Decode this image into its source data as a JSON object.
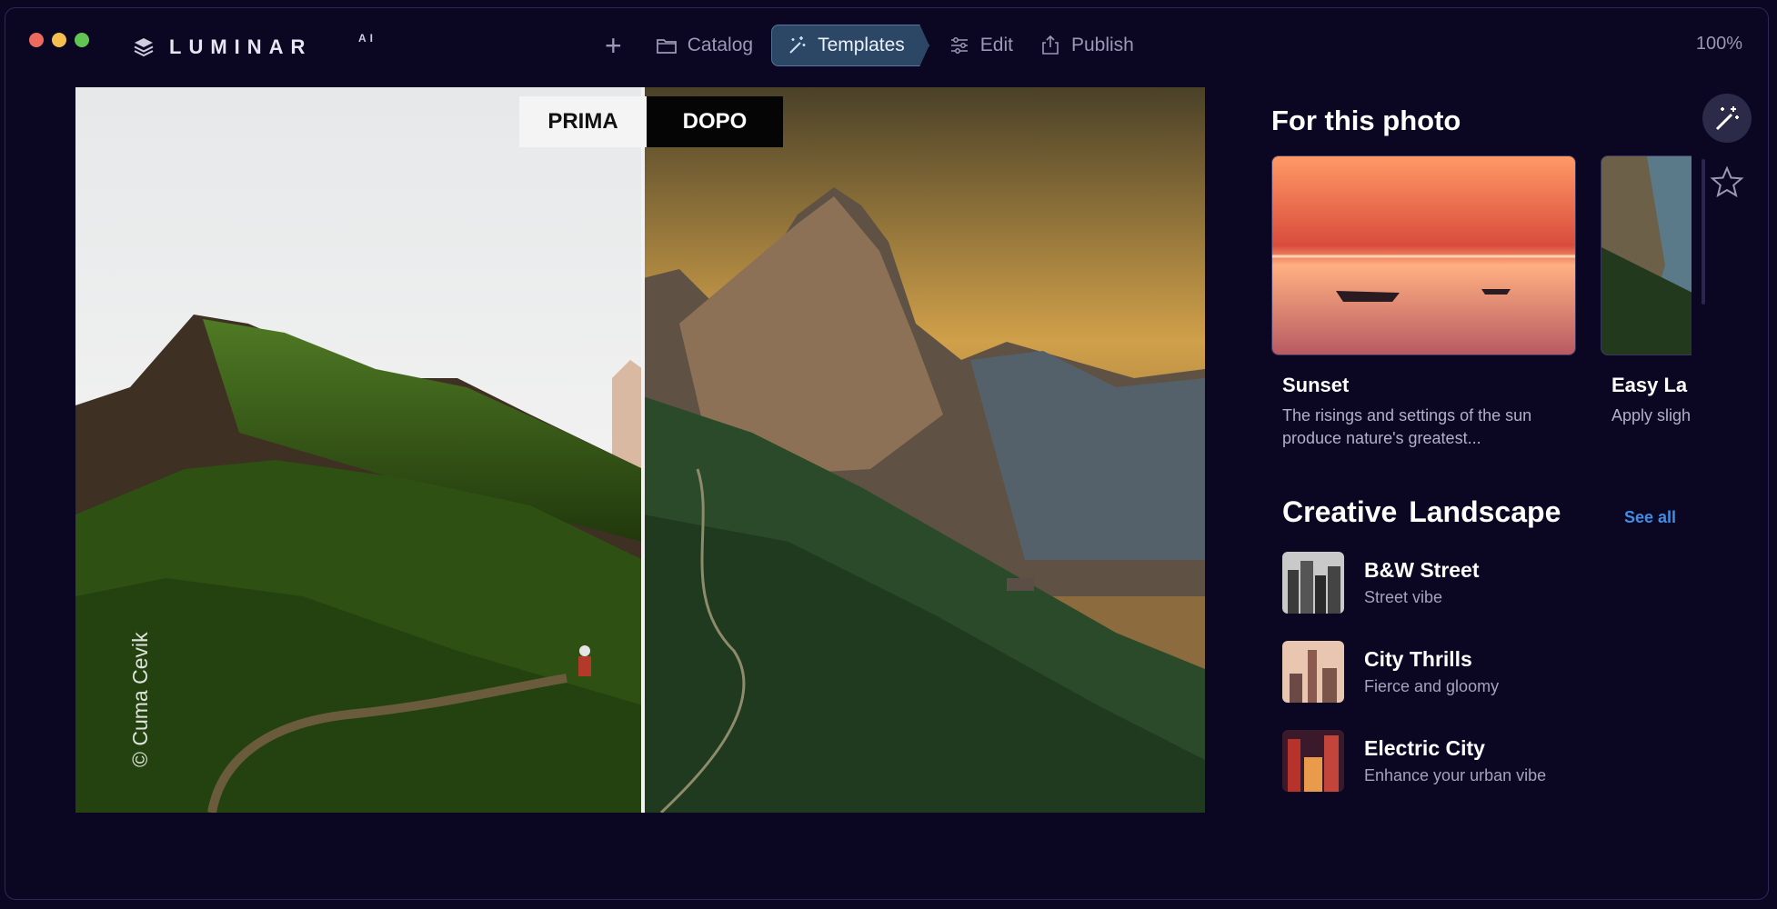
{
  "titlebar": {
    "brand_name": "LUMINAR",
    "brand_sup": "AI",
    "zoom": "100%"
  },
  "nav": {
    "add_label": "+",
    "items": [
      {
        "label": "Catalog",
        "icon": "folder-icon",
        "active": false
      },
      {
        "label": "Templates",
        "icon": "magic-wand-icon",
        "active": true
      },
      {
        "label": "Edit",
        "icon": "sliders-icon",
        "active": false
      },
      {
        "label": "Publish",
        "icon": "share-icon",
        "active": false
      }
    ]
  },
  "viewer": {
    "before_label": "PRIMA",
    "after_label": "DOPO",
    "credit": "© Cuma Cevik"
  },
  "panel": {
    "title": "For this photo",
    "cards": [
      {
        "title": "Sunset",
        "desc": "The risings and settings of the sun produce nature's greatest..."
      },
      {
        "title": "Easy La",
        "desc": "Apply sligh light and b"
      }
    ],
    "section_title": "Creative  Landscape",
    "see_all": "See all",
    "items": [
      {
        "title": "B&W Street",
        "subtitle": "Street vibe"
      },
      {
        "title": "City Thrills",
        "subtitle": "Fierce and gloomy"
      },
      {
        "title": "Electric City",
        "subtitle": "Enhance your urban vibe"
      }
    ]
  },
  "colors": {
    "background": "#0b0622",
    "active_tab": "#2c4665",
    "link": "#3e8ee8"
  }
}
